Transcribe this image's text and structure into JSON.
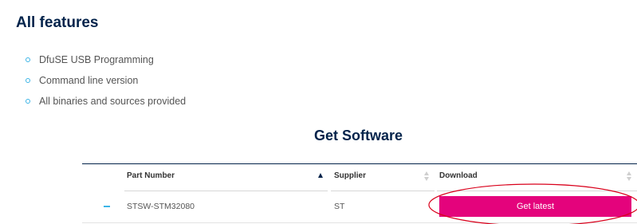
{
  "features": {
    "title": "All features",
    "items": [
      "DfuSE USB Programming",
      "Command line version",
      "All binaries and sources provided"
    ]
  },
  "software": {
    "title": "Get Software",
    "columns": {
      "part_number": "Part Number",
      "supplier": "Supplier",
      "download": "Download"
    },
    "sort": {
      "active_column": "part_number",
      "direction": "ascending"
    },
    "rows": [
      {
        "part_number": "STSW-STM32080",
        "supplier": "ST",
        "download_label": "Get latest"
      }
    ]
  },
  "colors": {
    "heading": "#03234b",
    "bullet": "#3cb4e6",
    "button": "#e4037c",
    "annotation": "#d9001b"
  }
}
